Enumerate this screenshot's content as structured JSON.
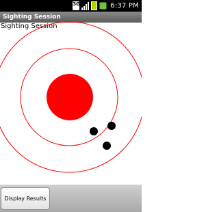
{
  "status_bar": {
    "signal_label": "3G",
    "time": "6:37 PM",
    "icons": [
      "network-3g-icon",
      "signal-strength-icon",
      "battery-icon",
      "charging-icon"
    ]
  },
  "app": {
    "title": "Sighting Session"
  },
  "main": {
    "session_label": "Sighting Session",
    "target": {
      "rings": 3,
      "ring_color": "#ff0000",
      "bullseye_color": "#ff0000",
      "shot_color": "#000000",
      "shots": 3
    }
  },
  "actions": {
    "display_results_label": "Display Results"
  }
}
